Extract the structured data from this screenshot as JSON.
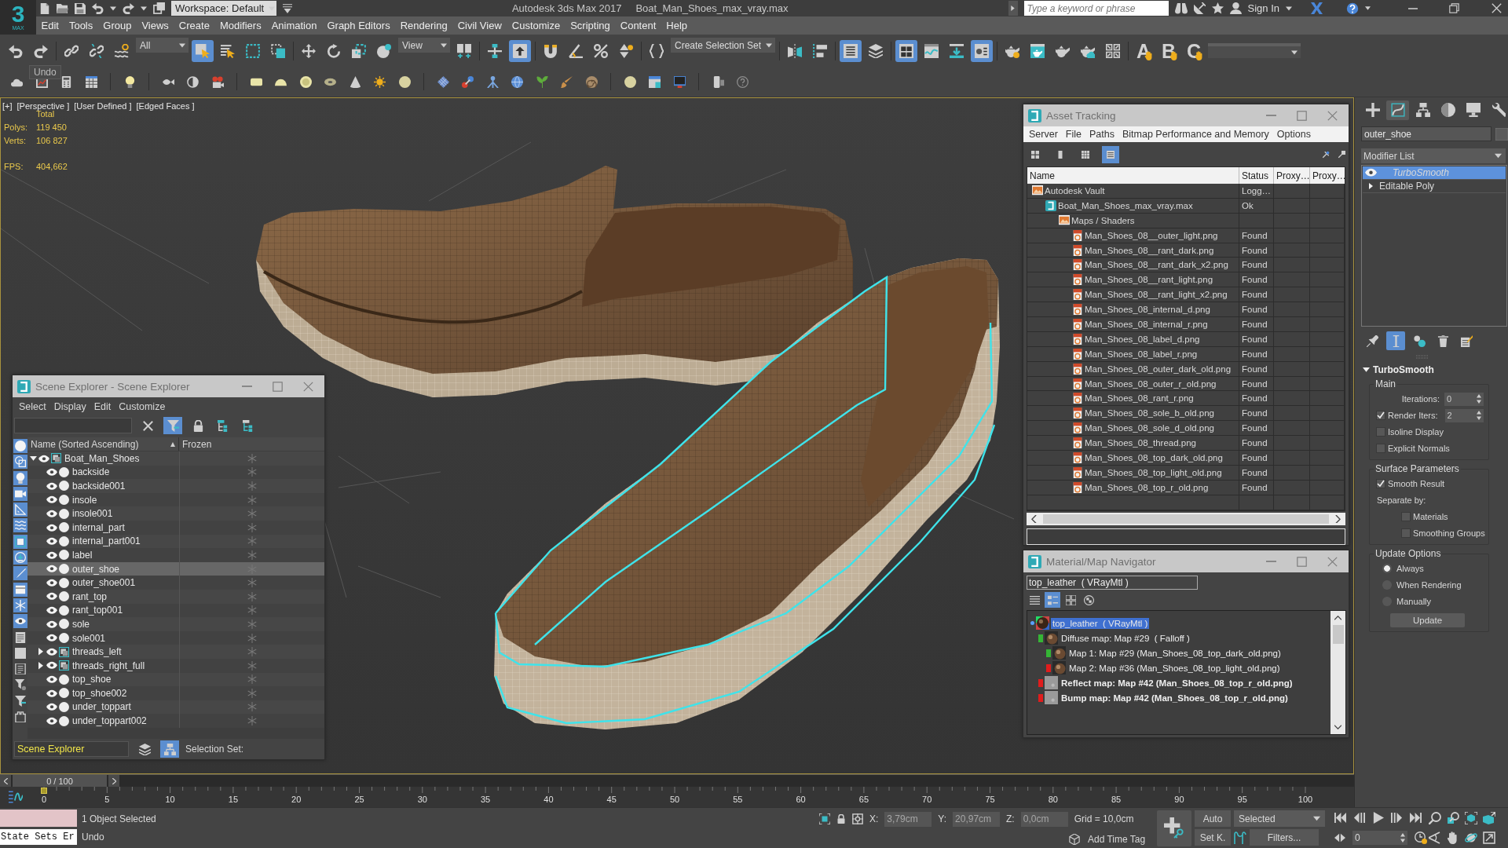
{
  "title_bar": {
    "logo": "3",
    "logo_caption": "MAX",
    "workspace": "Workspace: Default",
    "app_title": "Autodesk 3ds Max 2017",
    "file_title": "Boat_Man_Shoes_max_vray.max",
    "search": {
      "placeholder": "Type a keyword or phrase"
    },
    "sign_in": "Sign In"
  },
  "menu_bar": [
    "Edit",
    "Tools",
    "Group",
    "Views",
    "Create",
    "Modifiers",
    "Animation",
    "Graph Editors",
    "Rendering",
    "Civil View",
    "Customize",
    "Scripting",
    "Content",
    "Help"
  ],
  "main_toolbar": [
    {
      "kind": "undo",
      "selected": false
    },
    {
      "kind": "redo",
      "selected": false
    },
    {
      "kind": "separator"
    },
    {
      "kind": "link",
      "selected": false
    },
    {
      "kind": "unlink",
      "selected": false
    },
    {
      "kind": "bind",
      "selected": false
    },
    {
      "kind": "filterlist",
      "value": "All"
    },
    {
      "kind": "selectobject",
      "selected": true
    },
    {
      "kind": "selectbyname",
      "selected": false
    },
    {
      "kind": "rectregion",
      "selected": false
    },
    {
      "kind": "crossing",
      "selected": false
    },
    {
      "kind": "separator"
    },
    {
      "kind": "move",
      "selected": false
    },
    {
      "kind": "rotate",
      "selected": false
    },
    {
      "kind": "scale",
      "selected": false
    },
    {
      "kind": "placement",
      "selected": false
    },
    {
      "kind": "coordlist",
      "value": "View"
    },
    {
      "kind": "pivot",
      "selected": false
    },
    {
      "kind": "separator"
    },
    {
      "kind": "manipulate",
      "selected": false
    },
    {
      "kind": "shortcut",
      "selected": true
    },
    {
      "kind": "separator"
    },
    {
      "kind": "snap",
      "selected": false
    },
    {
      "kind": "anglesnap",
      "selected": false
    },
    {
      "kind": "percentsnap",
      "selected": false
    },
    {
      "kind": "spinnersnap",
      "selected": false
    },
    {
      "kind": "separator"
    },
    {
      "kind": "namedsets",
      "selected": false
    },
    {
      "kind": "setlist",
      "value": "Create Selection Set"
    },
    {
      "kind": "separator"
    },
    {
      "kind": "mirror",
      "selected": false
    },
    {
      "kind": "align",
      "selected": false
    },
    {
      "kind": "separator"
    },
    {
      "kind": "sceneexplorer",
      "selected": true
    },
    {
      "kind": "layers",
      "selected": false
    },
    {
      "kind": "separator"
    },
    {
      "kind": "ribbon",
      "selected": true
    },
    {
      "kind": "curveeditor",
      "selected": false
    },
    {
      "kind": "schematic",
      "selected": false
    },
    {
      "kind": "materialeditor",
      "selected": true
    },
    {
      "kind": "separator"
    },
    {
      "kind": "rendersetup",
      "selected": false
    },
    {
      "kind": "renderframe",
      "selected": false
    },
    {
      "kind": "render",
      "selected": false
    },
    {
      "kind": "cloudrender",
      "selected": false
    },
    {
      "kind": "gallery",
      "selected": false
    },
    {
      "kind": "separator"
    },
    {
      "kind": "letter",
      "label": "A",
      "selected": false
    },
    {
      "kind": "letter",
      "label": "B",
      "selected": false
    },
    {
      "kind": "letter",
      "label": "C",
      "selected": false
    },
    {
      "kind": "blanklist"
    }
  ],
  "tooltip": "Undo",
  "viewport": {
    "labels": [
      "[+]",
      "[Perspective ]",
      "[User Defined ]",
      "[Edged Faces ]"
    ],
    "stats_title": "Total",
    "stats": [
      {
        "label": "Polys:",
        "value": "119 450"
      },
      {
        "label": "Verts:",
        "value": "106 827"
      },
      {
        "label": "FPS:",
        "value": "404,662"
      }
    ]
  },
  "scene_explorer": {
    "title": "Scene Explorer - Scene Explorer",
    "menu": [
      "Select",
      "Display",
      "Edit",
      "Customize"
    ],
    "toolbar": [
      {
        "kind": "filter",
        "selected": true
      },
      {
        "kind": "lock",
        "selected": false
      },
      {
        "kind": "hierexpand",
        "selected": false
      },
      {
        "kind": "hiercollapse",
        "selected": false
      }
    ],
    "side_filters": [
      {
        "kind": "geometry",
        "on": true
      },
      {
        "kind": "shapes",
        "on": true
      },
      {
        "kind": "lights",
        "on": true
      },
      {
        "kind": "cameras",
        "on": true
      },
      {
        "kind": "helpers",
        "on": true
      },
      {
        "kind": "spacewarps",
        "on": true
      },
      {
        "kind": "groups",
        "on": true
      },
      {
        "kind": "xrefs",
        "on": true
      },
      {
        "kind": "bones",
        "on": true
      },
      {
        "kind": "containers",
        "on": true
      },
      {
        "kind": "frozen",
        "on": true
      },
      {
        "kind": "hidden",
        "on": true
      },
      {
        "kind": "all",
        "on": false
      },
      {
        "kind": "none",
        "on": false
      },
      {
        "kind": "invert",
        "on": false
      },
      {
        "kind": "advanced",
        "on": false
      },
      {
        "kind": "filter",
        "on": false
      },
      {
        "kind": "container",
        "on": false
      }
    ],
    "columns": [
      "Name (Sorted Ascending)",
      "Frozen"
    ],
    "tree": [
      {
        "name": "Boat_Man_Shoes",
        "kind": "group",
        "expanded": true,
        "selected": false,
        "visible": true,
        "frozen": false,
        "children": [
          {
            "name": "backside",
            "kind": "object",
            "selected": false,
            "visible": true,
            "frozen": false
          },
          {
            "name": "backside001",
            "kind": "object",
            "selected": false,
            "visible": true,
            "frozen": false
          },
          {
            "name": "insole",
            "kind": "object",
            "selected": false,
            "visible": true,
            "frozen": false
          },
          {
            "name": "insole001",
            "kind": "object",
            "selected": false,
            "visible": true,
            "frozen": false
          },
          {
            "name": "internal_part",
            "kind": "object",
            "selected": false,
            "visible": true,
            "frozen": false
          },
          {
            "name": "internal_part001",
            "kind": "object",
            "selected": false,
            "visible": true,
            "frozen": false
          },
          {
            "name": "label",
            "kind": "object",
            "selected": false,
            "visible": true,
            "frozen": false
          },
          {
            "name": "outer_shoe",
            "kind": "object",
            "selected": true,
            "visible": true,
            "frozen": false
          },
          {
            "name": "outer_shoe001",
            "kind": "object",
            "selected": false,
            "visible": true,
            "frozen": false
          },
          {
            "name": "rant_top",
            "kind": "object",
            "selected": false,
            "visible": true,
            "frozen": false
          },
          {
            "name": "rant_top001",
            "kind": "object",
            "selected": false,
            "visible": true,
            "frozen": false
          },
          {
            "name": "sole",
            "kind": "object",
            "selected": false,
            "visible": true,
            "frozen": false
          },
          {
            "name": "sole001",
            "kind": "object",
            "selected": false,
            "visible": true,
            "frozen": false
          },
          {
            "name": "threads_left",
            "kind": "group",
            "expanded": false,
            "selected": false,
            "visible": true,
            "frozen": false
          },
          {
            "name": "threads_right_full",
            "kind": "group",
            "expanded": false,
            "selected": false,
            "visible": true,
            "frozen": false
          },
          {
            "name": "top_shoe",
            "kind": "object",
            "selected": false,
            "visible": true,
            "frozen": false
          },
          {
            "name": "top_shoe002",
            "kind": "object",
            "selected": false,
            "visible": true,
            "frozen": false
          },
          {
            "name": "under_toppart",
            "kind": "object",
            "selected": false,
            "visible": true,
            "frozen": false
          },
          {
            "name": "under_toppart002",
            "kind": "object",
            "selected": false,
            "visible": true,
            "frozen": false
          }
        ]
      }
    ],
    "bottom": {
      "explorer": "Scene Explorer",
      "modes": [
        {
          "kind": "layers",
          "selected": false
        },
        {
          "kind": "hierarchy",
          "selected": true
        }
      ],
      "selection_set": "Selection Set:"
    }
  },
  "asset_tracking": {
    "title": "Asset Tracking",
    "menu": [
      "Server",
      "File",
      "Paths",
      "Bitmap Performance and Memory",
      "Options"
    ],
    "view_modes": [
      {
        "kind": "smallicons",
        "selected": false
      },
      {
        "kind": "list",
        "selected": false
      },
      {
        "kind": "thumbnails",
        "selected": false
      },
      {
        "kind": "details",
        "selected": true
      }
    ],
    "columns": [
      "Name",
      "Status",
      "Proxy…",
      "Proxy…"
    ],
    "tree": [
      {
        "name": "Autodesk Vault",
        "kind": "vault",
        "status": "Logg…",
        "children": [
          {
            "name": "Boat_Man_Shoes_max_vray.max",
            "kind": "scene",
            "status": "Ok",
            "children": [
              {
                "name": "Maps / Shaders",
                "kind": "folder",
                "children": [
                  {
                    "name": "Man_Shoes_08__outer_light.png",
                    "kind": "image",
                    "status": "Found"
                  },
                  {
                    "name": "Man_Shoes_08__rant_dark.png",
                    "kind": "image",
                    "status": "Found"
                  },
                  {
                    "name": "Man_Shoes_08__rant_dark_x2.png",
                    "kind": "image",
                    "status": "Found"
                  },
                  {
                    "name": "Man_Shoes_08__rant_light.png",
                    "kind": "image",
                    "status": "Found"
                  },
                  {
                    "name": "Man_Shoes_08__rant_light_x2.png",
                    "kind": "image",
                    "status": "Found"
                  },
                  {
                    "name": "Man_Shoes_08_internal_d.png",
                    "kind": "image",
                    "status": "Found"
                  },
                  {
                    "name": "Man_Shoes_08_internal_r.png",
                    "kind": "image",
                    "status": "Found"
                  },
                  {
                    "name": "Man_Shoes_08_label_d.png",
                    "kind": "image",
                    "status": "Found"
                  },
                  {
                    "name": "Man_Shoes_08_label_r.png",
                    "kind": "image",
                    "status": "Found"
                  },
                  {
                    "name": "Man_Shoes_08_outer_dark_old.png",
                    "kind": "image",
                    "status": "Found"
                  },
                  {
                    "name": "Man_Shoes_08_outer_r_old.png",
                    "kind": "image",
                    "status": "Found"
                  },
                  {
                    "name": "Man_Shoes_08_rant_r.png",
                    "kind": "image",
                    "status": "Found"
                  },
                  {
                    "name": "Man_Shoes_08_sole_b_old.png",
                    "kind": "image",
                    "status": "Found"
                  },
                  {
                    "name": "Man_Shoes_08_sole_d_old.png",
                    "kind": "image",
                    "status": "Found"
                  },
                  {
                    "name": "Man_Shoes_08_thread.png",
                    "kind": "image",
                    "status": "Found"
                  },
                  {
                    "name": "Man_Shoes_08_top_dark_old.png",
                    "kind": "image",
                    "status": "Found"
                  },
                  {
                    "name": "Man_Shoes_08_top_light_old.png",
                    "kind": "image",
                    "status": "Found"
                  },
                  {
                    "name": "Man_Shoes_08_top_r_old.png",
                    "kind": "image",
                    "status": "Found"
                  }
                ]
              }
            ]
          }
        ]
      }
    ]
  },
  "material_navigator": {
    "title": "Material/Map Navigator",
    "field": "top_leather  ( VRayMtl )",
    "view_modes": [
      {
        "kind": "navlist",
        "selected": false
      },
      {
        "kind": "navlisticons",
        "selected": true
      },
      {
        "kind": "navsmall",
        "selected": false
      },
      {
        "kind": "navlarge",
        "selected": false
      }
    ],
    "tree": [
      {
        "name": "top_leather  ( VRayMtl )",
        "kind": "material",
        "selected": true,
        "children": [
          {
            "name": "Diffuse map: Map #29  ( Falloff )",
            "kind": "leather",
            "color": "#35b535",
            "emphasis": false,
            "selected": false,
            "children": [
              {
                "name": "Map 1: Map #29 (Man_Shoes_08_top_dark_old.png)",
                "kind": "leather",
                "color": "#35b535",
                "emphasis": false,
                "selected": false
              },
              {
                "name": "Map 2: Map #36 (Man_Shoes_08_top_light_old.png)",
                "kind": "leather",
                "color": "#e01c1c",
                "emphasis": false,
                "selected": false
              }
            ]
          },
          {
            "name": "Reflect map: Map #42 (Man_Shoes_08_top_r_old.png)",
            "kind": "grayscale",
            "color": "#e01c1c",
            "emphasis": true,
            "selected": false
          },
          {
            "name": "Bump map: Map #42 (Man_Shoes_08_top_r_old.png)",
            "kind": "grayscale",
            "color": "#e01c1c",
            "emphasis": true,
            "selected": false
          }
        ]
      }
    ]
  },
  "command_panel": {
    "tabs": [
      {
        "kind": "create",
        "selected": false
      },
      {
        "kind": "modify",
        "selected": true
      },
      {
        "kind": "hierarchy",
        "selected": false
      },
      {
        "kind": "motion",
        "selected": false
      },
      {
        "kind": "display",
        "selected": false
      },
      {
        "kind": "utilities",
        "selected": false
      }
    ],
    "object_name": "outer_shoe",
    "modifier_list": "Modifier List",
    "stack": [
      {
        "name": "TurboSmooth",
        "kind": "modifier",
        "selected": true,
        "enabled": true
      },
      {
        "name": "Editable Poly",
        "kind": "base",
        "selected": false,
        "expanded": false
      }
    ],
    "stack_tools": [
      {
        "kind": "pin",
        "selected": false
      },
      {
        "kind": "endresult",
        "selected": true
      },
      {
        "kind": "unique",
        "selected": false
      },
      {
        "kind": "remove",
        "selected": false
      },
      {
        "kind": "configure",
        "selected": false
      }
    ],
    "rollout": {
      "title": "TurboSmooth",
      "expanded": true,
      "groups": [
        {
          "title": "Main",
          "controls": [
            {
              "kind": "spinner",
              "label": "Iterations:",
              "value": "0"
            },
            {
              "kind": "checkspinner",
              "label": "Render Iters:",
              "checked": true,
              "value": "2"
            },
            {
              "kind": "checkbox",
              "label": "Isoline Display",
              "checked": false
            },
            {
              "kind": "checkbox",
              "label": "Explicit Normals",
              "checked": false
            }
          ]
        },
        {
          "title": "Surface Parameters",
          "controls": [
            {
              "kind": "checkbox",
              "label": "Smooth Result",
              "checked": true
            },
            {
              "kind": "label",
              "label": "Separate by:",
              "children": [
                {
                  "kind": "checkbox",
                  "label": "Materials",
                  "checked": false
                },
                {
                  "kind": "checkbox",
                  "label": "Smoothing Groups",
                  "checked": false
                }
              ]
            }
          ]
        },
        {
          "title": "Update Options",
          "controls": [
            {
              "kind": "radio",
              "label": "Always",
              "selected": true
            },
            {
              "kind": "radio",
              "label": "When Rendering",
              "selected": false
            },
            {
              "kind": "radio",
              "label": "Manually",
              "selected": false
            },
            {
              "kind": "button",
              "label": "Update"
            }
          ]
        }
      ]
    }
  },
  "time_slider": {
    "position": "0 / 100",
    "level": 0,
    "ticks": [
      "0",
      "5",
      "10",
      "15",
      "20",
      "25",
      "30",
      "35",
      "40",
      "45",
      "50",
      "55",
      "60",
      "65",
      "70",
      "75",
      "80",
      "85",
      "90",
      "95",
      "100"
    ]
  },
  "status_bar": {
    "state_sets": "State Sets Er",
    "selection_info": "1 Object Selected",
    "prompt": "Undo",
    "coords": [
      {
        "axis": "X:",
        "value": "3,79cm",
        "disabled": true
      },
      {
        "axis": "Y:",
        "value": "20,97cm",
        "disabled": true
      },
      {
        "axis": "Z:",
        "value": "0,0cm",
        "disabled": true
      }
    ],
    "grid": "Grid = 10,0cm",
    "time_tag": "Add Time Tag",
    "key_buttons": [
      {
        "label": "Auto",
        "selected": false
      },
      {
        "label": "Set K.",
        "selected": false
      }
    ],
    "key_mode": "Selected",
    "filters": "Filters...",
    "frame": "0"
  }
}
